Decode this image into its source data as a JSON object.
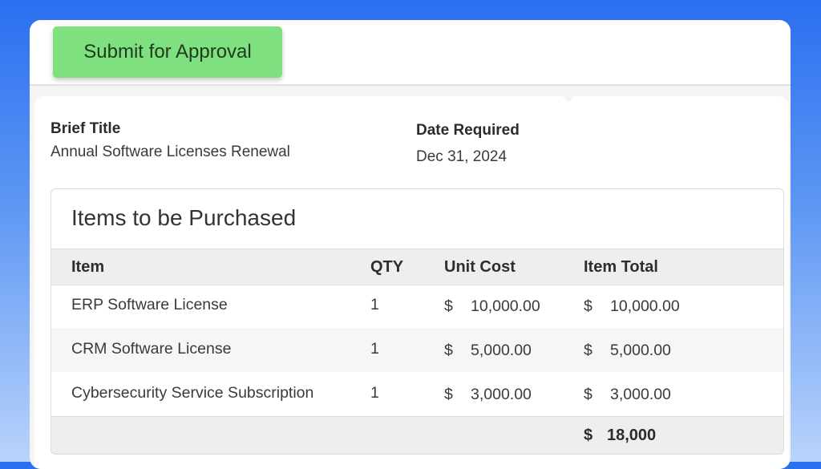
{
  "toolbar": {
    "submit_label": "Submit for Approval"
  },
  "request": {
    "title_label": "Brief Title",
    "title_value": "Annual Software Licenses Renewal",
    "date_label": "Date Required",
    "date_value": "Dec 31, 2024"
  },
  "items": {
    "heading": "Items to be Purchased",
    "columns": [
      "Item",
      "QTY",
      "Unit Cost",
      "Item Total"
    ],
    "rows": [
      {
        "item": "ERP Software License",
        "qty": "1",
        "currency": "$",
        "unit_cost": "10,000.00",
        "item_total": "10,000.00"
      },
      {
        "item": "CRM Software License",
        "qty": "1",
        "currency": "$",
        "unit_cost": "5,000.00",
        "item_total": "5,000.00"
      },
      {
        "item": "Cybersecurity Service Subscription",
        "qty": "1",
        "currency": "$",
        "unit_cost": "3,000.00",
        "item_total": "3,000.00"
      }
    ],
    "grand_total_currency": "$",
    "grand_total": "18,000"
  },
  "colors": {
    "submit_button": "#7ee07e",
    "background_top": "#2a6ff0",
    "background_bottom": "#b9d3fb",
    "header_row": "#eeeeee"
  }
}
